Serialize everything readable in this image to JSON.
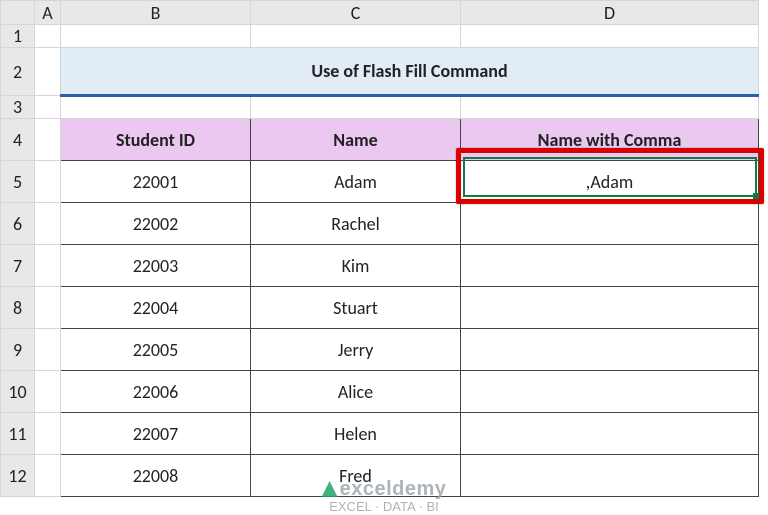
{
  "columns": [
    "",
    "A",
    "B",
    "C",
    "D"
  ],
  "rows": [
    "1",
    "2",
    "3",
    "4",
    "5",
    "6",
    "7",
    "8",
    "9",
    "10",
    "11",
    "12"
  ],
  "title": "Use of Flash Fill Command",
  "headers": {
    "b": "Student ID",
    "c": "Name",
    "d": "Name with Comma"
  },
  "chart_data": {
    "type": "table",
    "columns": [
      "Student ID",
      "Name",
      "Name with Comma"
    ],
    "rows": [
      [
        "22001",
        "Adam",
        ",Adam"
      ],
      [
        "22002",
        "Rachel",
        ""
      ],
      [
        "22003",
        "Kim",
        ""
      ],
      [
        "22004",
        "Stuart",
        ""
      ],
      [
        "22005",
        "Jerry",
        ""
      ],
      [
        "22006",
        "Alice",
        ""
      ],
      [
        "22007",
        "Helen",
        ""
      ],
      [
        "22008",
        "Fred",
        ""
      ]
    ],
    "title": "Use of Flash Fill Command"
  },
  "selected_cell": "D5",
  "watermark": {
    "brand": "exceldemy",
    "tagline": "EXCEL · DATA · BI"
  }
}
